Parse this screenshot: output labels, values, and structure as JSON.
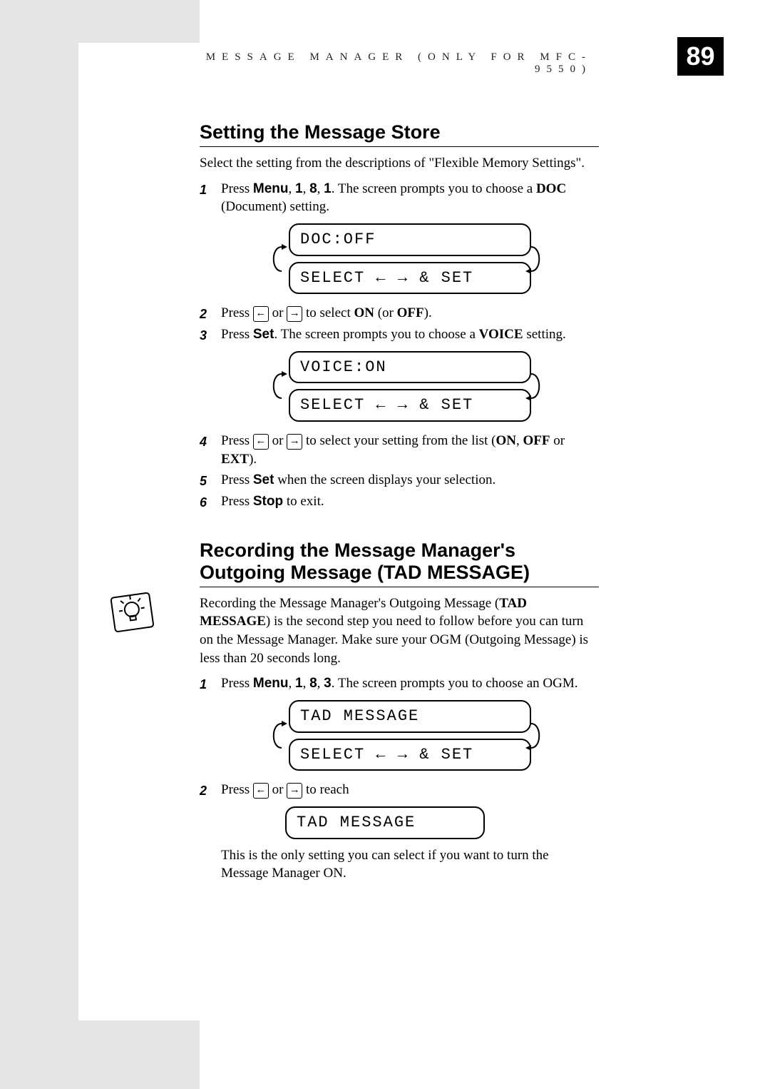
{
  "header": {
    "chapter": "MESSAGE MANAGER (ONLY FOR MFC-9550)",
    "page": "89"
  },
  "sec1": {
    "title": "Setting the Message Store",
    "intro": "Select the setting from the descriptions of \"Flexible Memory Settings\".",
    "s1a": "Press ",
    "s1menu": "Menu",
    "s1b": ", ",
    "s1k1": "1",
    "s1c": ", ",
    "s1k2": "8",
    "s1d": ", ",
    "s1k3": "1",
    "s1e": ". The screen prompts you to choose a ",
    "s1doc": "DOC",
    "s1f": " (Document) setting.",
    "lcd1a": "DOC:OFF",
    "lcd1b": "SELECT ← → & SET",
    "s2a": "Press ",
    "s2b": " or ",
    "s2c": " to select ",
    "s2on": "ON",
    "s2d": " (or ",
    "s2off": "OFF",
    "s2e": ").",
    "s3a": "Press ",
    "s3set": "Set",
    "s3b": ". The screen prompts you to choose a ",
    "s3voice": "VOICE",
    "s3c": " setting.",
    "lcd2a": "VOICE:ON",
    "lcd2b": "SELECT ← → & SET",
    "s4a": "Press ",
    "s4b": " or ",
    "s4c": " to select your setting from the list (",
    "s4on": "ON",
    "s4d": ", ",
    "s4off": "OFF",
    "s4e": " or ",
    "s4ext": "EXT",
    "s4f": ").",
    "s5a": "Press ",
    "s5set": "Set",
    "s5b": " when the screen displays your selection.",
    "s6a": "Press ",
    "s6stop": "Stop",
    "s6b": " to exit."
  },
  "sec2": {
    "title": "Recording the Message Manager's Outgoing Message (TAD MESSAGE)",
    "p1a": "Recording the Message Manager's Outgoing Message (",
    "p1tad": "TAD MESSAGE",
    "p1b": ") is the second step you need to follow before you can turn on the Message Manager. Make sure your OGM (Outgoing Message) is less than 20 seconds long.",
    "s1a": "Press ",
    "s1menu": "Menu",
    "s1b": ", ",
    "s1k1": "1",
    "s1c": ", ",
    "s1k2": "8",
    "s1d": ", ",
    "s1k3": "3",
    "s1e": ". The screen prompts you to choose an OGM.",
    "lcd3a": "TAD MESSAGE",
    "lcd3b": "SELECT ← → & SET",
    "s2a": "Press ",
    "s2b": " or ",
    "s2c": " to reach",
    "lcd4": "TAD MESSAGE",
    "follow": "This is the only setting you can select if you want to turn the Message Manager ON."
  },
  "keys": {
    "left": "←",
    "right": "→"
  },
  "nums": {
    "n1": "1",
    "n2": "2",
    "n3": "3",
    "n4": "4",
    "n5": "5",
    "n6": "6"
  }
}
